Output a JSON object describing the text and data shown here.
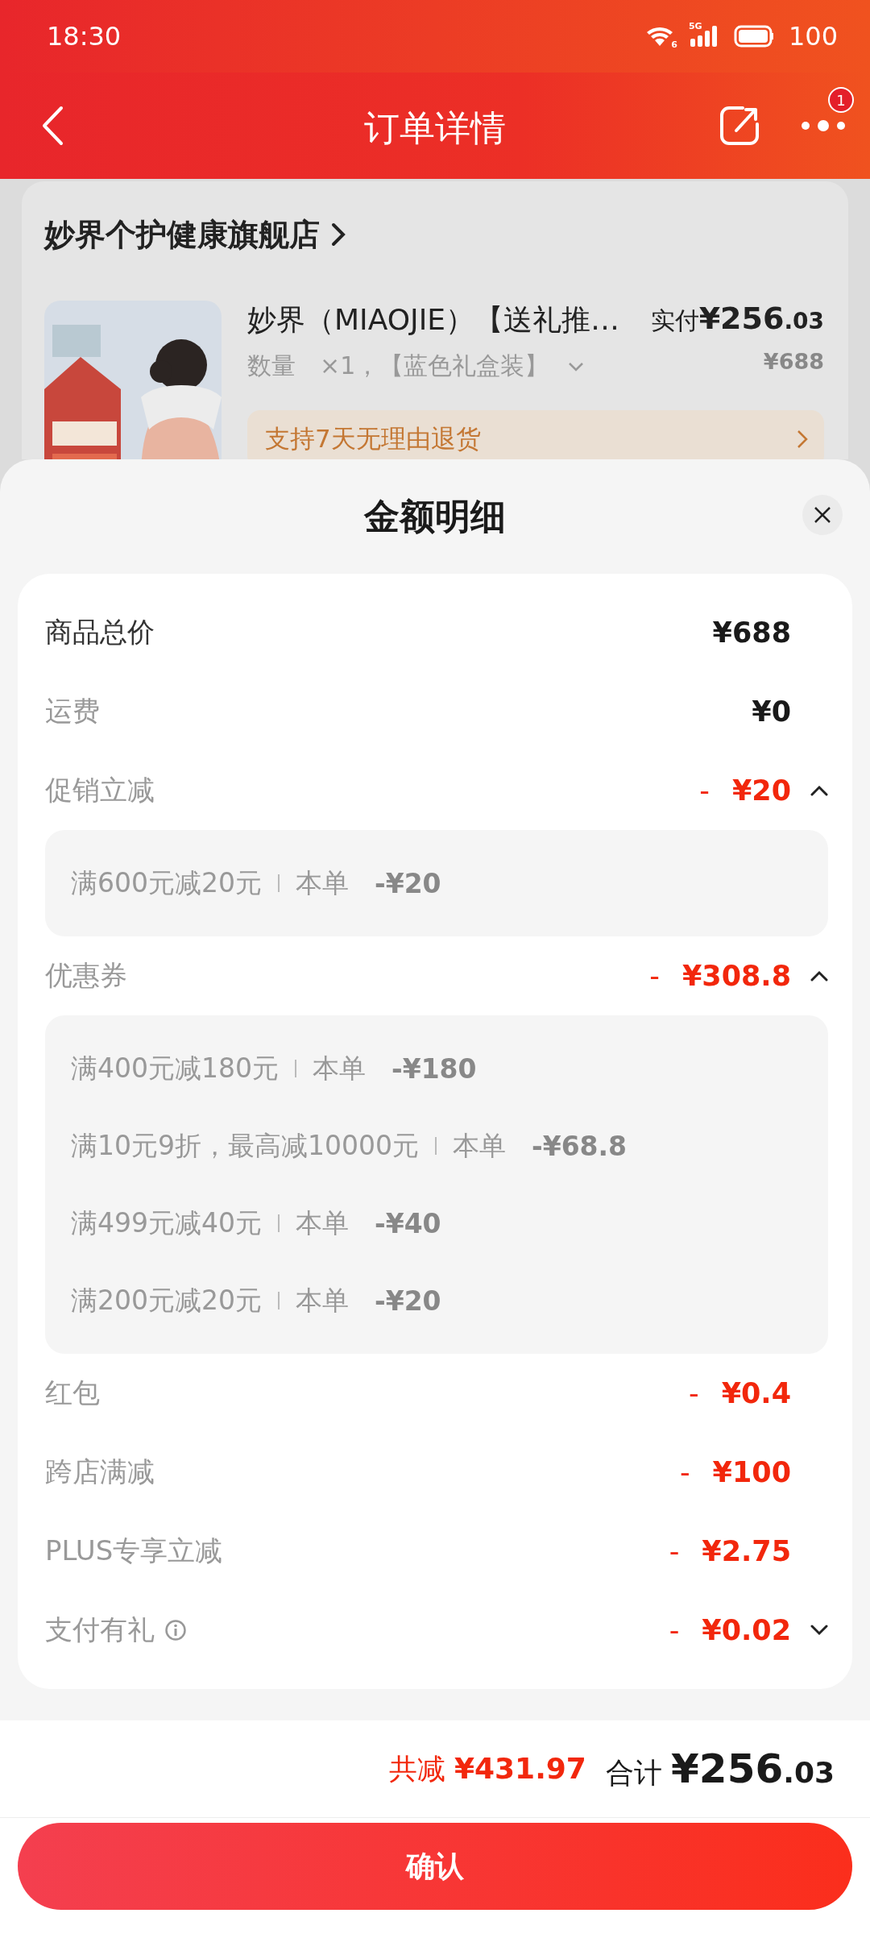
{
  "status_bar": {
    "time": "18:30",
    "wifi_label": "6",
    "signal_label": "5G",
    "battery": "100"
  },
  "header": {
    "title": "订单详情",
    "badge": "1"
  },
  "store": {
    "name": "妙界个护健康旗舰店"
  },
  "product": {
    "kind": "picture",
    "title": "妙界（MIAOJIE）【送礼推…",
    "quantity_label": "数量",
    "spec": "×1，【蓝色礼盒装】",
    "paid_label": "实付",
    "paid_amount": "¥256",
    "paid_decimal": ".03",
    "original_price": "¥688",
    "return_policy": "支持7天无理由退货"
  },
  "sheet": {
    "title": "金额明细",
    "rows": [
      {
        "kind": "total",
        "label": "商品总价",
        "amount": "¥688"
      },
      {
        "kind": "fee",
        "label": "运费",
        "amount": "¥0"
      },
      {
        "kind": "discount",
        "label": "促销立减",
        "sign": "-",
        "amount": "¥20",
        "expanded": true,
        "details": [
          {
            "condition": "满600元减20元",
            "scope": "本单",
            "amount": "-¥20"
          }
        ]
      },
      {
        "kind": "discount",
        "label": "优惠券",
        "sign": "-",
        "amount": "¥308.8",
        "expanded": true,
        "details": [
          {
            "condition": "满400元减180元",
            "scope": "本单",
            "amount": "-¥180"
          },
          {
            "condition": "满10元9折，最高减10000元",
            "scope": "本单",
            "amount": "-¥68.8"
          },
          {
            "condition": "满499元减40元",
            "scope": "本单",
            "amount": "-¥40"
          },
          {
            "condition": "满200元减20元",
            "scope": "本单",
            "amount": "-¥20"
          }
        ]
      },
      {
        "kind": "discount",
        "label": "红包",
        "sign": "-",
        "amount": "¥0.4"
      },
      {
        "kind": "discount",
        "label": "跨店满减",
        "sign": "-",
        "amount": "¥100"
      },
      {
        "kind": "discount",
        "label": "PLUS专享立减",
        "sign": "-",
        "amount": "¥2.75"
      },
      {
        "kind": "discount",
        "label": "支付有礼",
        "info": true,
        "sign": "-",
        "amount": "¥0.02",
        "expanded": false
      }
    ]
  },
  "footer": {
    "saved_label": "共减",
    "saved_amount": "¥431.97",
    "total_label": "合计",
    "total_amount": "¥256",
    "total_decimal": ".03"
  },
  "confirm_button": "确认"
}
